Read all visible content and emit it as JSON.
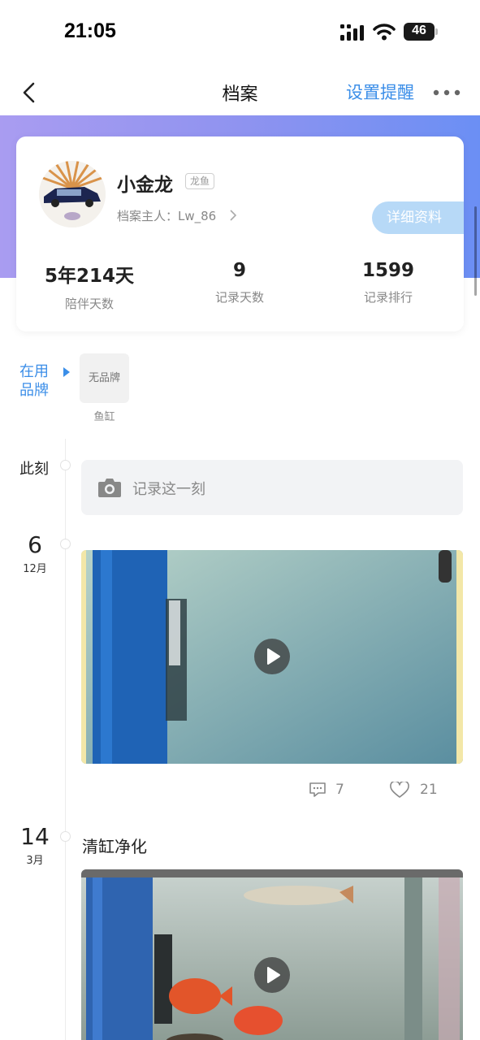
{
  "status_bar": {
    "time": "21:05",
    "battery": "46"
  },
  "nav": {
    "title": "档案",
    "remind": "设置提醒",
    "back_icon": "chevron-left-icon",
    "more_icon": "more-dots-icon"
  },
  "colors": {
    "accent": "#3b8ee8",
    "banner_start": "#a99cf1",
    "banner_end": "#6b8ff4",
    "detail_button": "#b7d9f7"
  },
  "profile": {
    "name": "小金龙",
    "tag": "龙鱼",
    "owner": "档案主人：Lw_86",
    "detail_button": "详细资料",
    "stats": [
      {
        "value": "5年214天",
        "label": "陪伴天数"
      },
      {
        "value": "9",
        "label": "记录天数"
      },
      {
        "value": "1599",
        "label": "记录排行"
      }
    ]
  },
  "brand": {
    "label_line1": "在用",
    "label_line2": "品牌",
    "chip": "无品牌",
    "caption": "鱼缸"
  },
  "timeline": {
    "now_label": "此刻",
    "record_placeholder": "记录这一刻",
    "entries": [
      {
        "day": "6",
        "month": "12月",
        "comments": "7",
        "likes": "21"
      },
      {
        "day": "14",
        "month": "3月",
        "title": "清缸净化"
      }
    ]
  }
}
